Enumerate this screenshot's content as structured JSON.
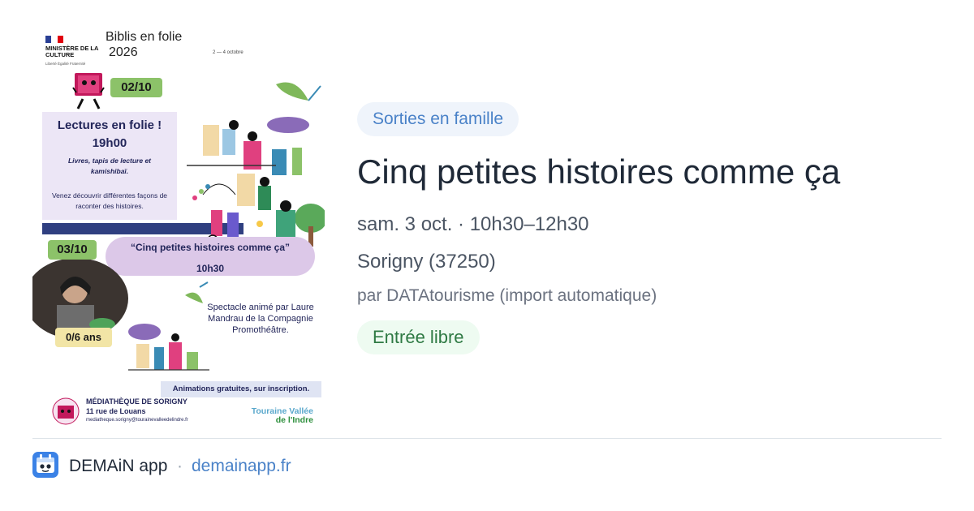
{
  "poster": {
    "gov_name": "MINISTÈRE DE LA CULTURE",
    "gov_motto": "Liberté Égalité Fraternité",
    "title_line1": "Biblis en folie",
    "title_line2": "2026",
    "dates": "2 — 4 octobre",
    "day1_date": "02/10",
    "day1_title": "Lectures en folie !",
    "day1_time": "19h00",
    "day1_subtitle": "Livres, tapis de lecture et kamishibaï.",
    "day1_desc": "Venez découvrir différentes façons de raconter des histoires.",
    "day2_date": "03/10",
    "day2_quote": "“Cinq petites histoires comme ça”",
    "day2_time": "10h30",
    "age": "0/6 ans",
    "show_desc": "Spectacle animé par Laure Mandrau de la Compagnie Promothéâtre.",
    "free_note": "Animations gratuites, sur inscription.",
    "library_name": "MÉDIATHÈQUE DE SORIGNY",
    "library_address": "11 rue de Louans",
    "library_email": "mediatheque.sorigny@tourainevalleedelindre.fr",
    "partner_line1": "Touraine Vallée",
    "partner_line2": "de l'Indre"
  },
  "event": {
    "category": "Sorties en famille",
    "title": "Cinq petites histoires comme ça",
    "when": "sam. 3 oct. · 10h30–12h30",
    "where": "Sorigny (37250)",
    "source": "par DATAtourisme (import automatique)",
    "price": "Entrée libre"
  },
  "footer": {
    "app_name": "DEMAiN app",
    "separator": "·",
    "domain": "demainapp.fr"
  },
  "colors": {
    "tag_text": "#4a82c8",
    "tag_bg": "#eff4fb",
    "entry_text": "#2f7a44",
    "entry_bg": "#eefbf1",
    "title": "#1f2937",
    "app_icon": "#3b82e6"
  },
  "icons": {
    "app": "app-logo-icon"
  }
}
